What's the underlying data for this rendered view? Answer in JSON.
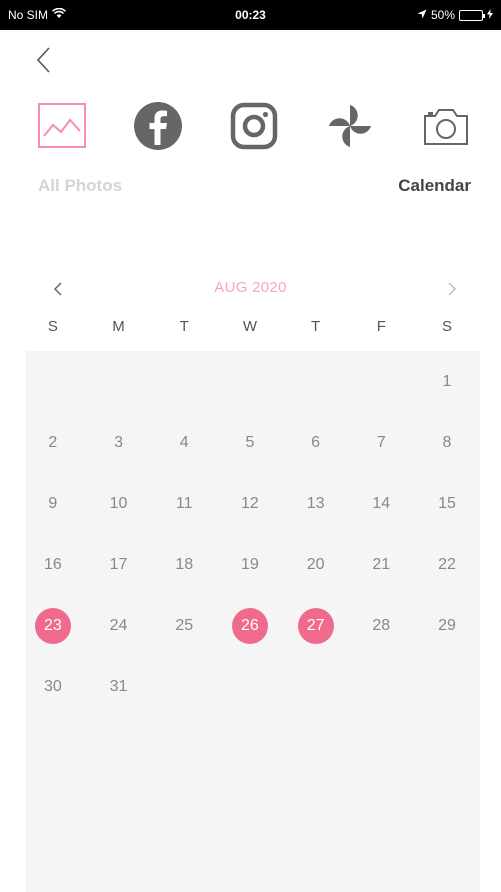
{
  "status": {
    "carrier": "No SIM",
    "time": "00:23",
    "battery": "50%",
    "battery_level": 0.5
  },
  "header": {
    "back_icon": "chevron-left-icon"
  },
  "sources": [
    {
      "name": "all-photos",
      "icon": "landscape-icon",
      "selected": true
    },
    {
      "name": "facebook",
      "icon": "facebook-icon"
    },
    {
      "name": "instagram",
      "icon": "instagram-icon"
    },
    {
      "name": "google-photos",
      "icon": "pinwheel-icon"
    },
    {
      "name": "camera",
      "icon": "camera-icon"
    }
  ],
  "labels": {
    "all_photos": "All Photos",
    "calendar": "Calendar"
  },
  "calendar": {
    "month_label": "AUG 2020",
    "weekdays": [
      "S",
      "M",
      "T",
      "W",
      "T",
      "F",
      "S"
    ],
    "weeks": [
      [
        "",
        "",
        "",
        "",
        "",
        "",
        "1"
      ],
      [
        "2",
        "3",
        "4",
        "5",
        "6",
        "7",
        "8"
      ],
      [
        "9",
        "10",
        "11",
        "12",
        "13",
        "14",
        "15"
      ],
      [
        "16",
        "17",
        "18",
        "19",
        "20",
        "21",
        "22"
      ],
      [
        "23",
        "24",
        "25",
        "26",
        "27",
        "28",
        "29"
      ],
      [
        "30",
        "31",
        "",
        "",
        "",
        "",
        ""
      ]
    ],
    "highlighted_days": [
      "23",
      "26",
      "27"
    ],
    "highlight_color": "#f06a8d"
  }
}
